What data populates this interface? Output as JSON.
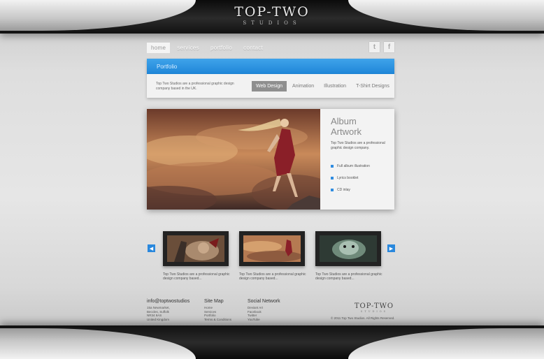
{
  "brand": {
    "name": "TOP-TWO",
    "sub": "STUDIOS"
  },
  "nav": {
    "items": [
      "home",
      "services",
      "portfolio",
      "contact"
    ]
  },
  "social": {
    "twitter_glyph": "t",
    "facebook_glyph": "f"
  },
  "portfolio": {
    "title": "Portfolio",
    "intro": "Top Two Studios are a professional graphic design company based in the UK.",
    "tabs": [
      "Web Design",
      "Animation",
      "Illustration",
      "T-Shirt Designs"
    ]
  },
  "featured": {
    "title": "Album Artwork",
    "description": "Top Two Studios are a professional graphic design company.",
    "items": [
      "Full album illustration",
      "Lyrics booklet",
      "CD inlay"
    ]
  },
  "carousel": {
    "prev_glyph": "◀",
    "next_glyph": "▶",
    "thumbs": [
      {
        "caption": "Top Two Studios are a professional graphic design company based..."
      },
      {
        "caption": "Top Two Studios are a professional graphic design company based..."
      },
      {
        "caption": "Top Two Studios are a professional graphic design company based..."
      }
    ]
  },
  "footer": {
    "contact": {
      "title": "info@toptwostudios",
      "lines": [
        "15a Newmarket,",
        "Beccles, Suffolk",
        "NR34 9AS",
        "United Kingdom"
      ]
    },
    "sitemap": {
      "title": "Site Map",
      "lines": [
        "Home",
        "Services",
        "Portfolio",
        "Terms & Conditions"
      ]
    },
    "social": {
      "title": "Social Network",
      "lines": [
        "Deviant Art",
        "Facebook",
        "Twitter",
        "YouTube"
      ]
    },
    "logo": {
      "name": "TOP-TWO",
      "sub": "STUDIOS"
    },
    "copyright": "© 2011 Top Two Studios. All Rights Reserved."
  },
  "colors": {
    "accent": "#2a88dd",
    "panel": "#f2f2f2",
    "dark_bar": "#1c1c1c"
  }
}
